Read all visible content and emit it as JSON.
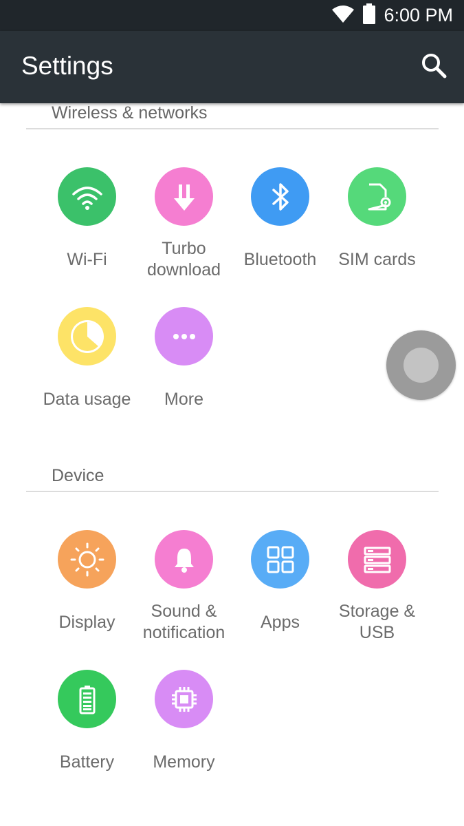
{
  "status_bar": {
    "time": "6:00 PM",
    "icons": [
      "wifi-icon",
      "battery-icon"
    ]
  },
  "app_bar": {
    "title": "Settings",
    "search_icon": "search-icon"
  },
  "sections": [
    {
      "header": "Wireless & networks",
      "items": [
        {
          "label": "Wi-Fi",
          "icon": "wifi-icon",
          "color": "#3bc16a"
        },
        {
          "label": "Turbo\ndownload",
          "icon": "turbo-download-icon",
          "color": "#f57ed1"
        },
        {
          "label": "Bluetooth",
          "icon": "bluetooth-icon",
          "color": "#3f9bf3"
        },
        {
          "label": "SIM cards",
          "icon": "sim-card-icon",
          "color": "#55d97a"
        },
        {
          "label": "Data usage",
          "icon": "data-usage-icon",
          "color": "#fde367"
        },
        {
          "label": "More",
          "icon": "more-icon",
          "color": "#d88cf5"
        }
      ]
    },
    {
      "header": "Device",
      "items": [
        {
          "label": "Display",
          "icon": "display-brightness-icon",
          "color": "#f6a35b"
        },
        {
          "label": "Sound &\nnotification",
          "icon": "bell-icon",
          "color": "#f57ed1"
        },
        {
          "label": "Apps",
          "icon": "apps-grid-icon",
          "color": "#58acf6"
        },
        {
          "label": "Storage &\nUSB",
          "icon": "storage-icon",
          "color": "#f06cac"
        },
        {
          "label": "Battery",
          "icon": "battery-icon",
          "color": "#35c95c"
        },
        {
          "label": "Memory",
          "icon": "memory-chip-icon",
          "color": "#d88cf5"
        }
      ]
    }
  ],
  "assistive_touch": {
    "icon": "assistive-touch-icon"
  }
}
